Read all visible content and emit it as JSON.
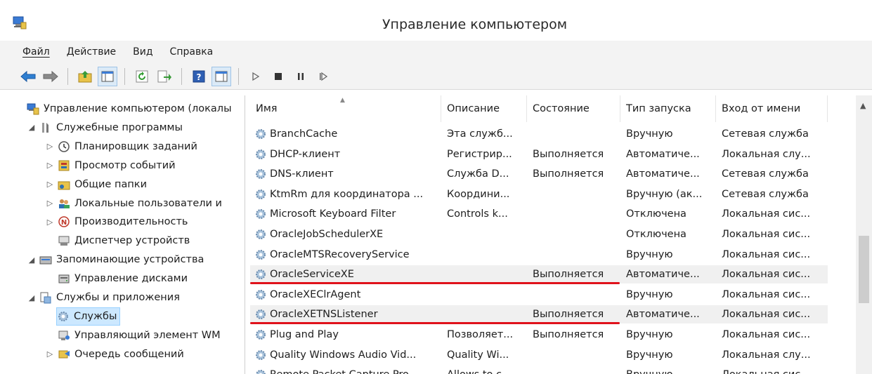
{
  "window": {
    "title": "Управление компьютером",
    "icon": "computer-management-icon"
  },
  "menu": {
    "file": "Файл",
    "action": "Действие",
    "view": "Вид",
    "help": "Справка"
  },
  "toolbar": {
    "buttons": [
      "back-arrow-icon",
      "forward-arrow-icon",
      "up-folder-icon",
      "show-hide-tree-icon",
      "refresh-icon",
      "export-list-icon",
      "help-icon",
      "properties-icon",
      "play-icon",
      "stop-icon",
      "pause-icon",
      "resume-icon"
    ]
  },
  "tree": {
    "items": [
      {
        "label": "Управление компьютером (локалы",
        "icon": "computer-management-icon",
        "level": 0,
        "arrow": ""
      },
      {
        "label": "Служебные программы",
        "icon": "tools-icon",
        "level": 1,
        "arrow": "◢"
      },
      {
        "label": "Планировщик заданий",
        "icon": "clock-icon",
        "level": 2,
        "arrow": "▷"
      },
      {
        "label": "Просмотр событий",
        "icon": "event-viewer-icon",
        "level": 2,
        "arrow": "▷"
      },
      {
        "label": "Общие папки",
        "icon": "shared-folder-icon",
        "level": 2,
        "arrow": "▷"
      },
      {
        "label": "Локальные пользователи и",
        "icon": "users-icon",
        "level": 2,
        "arrow": "▷"
      },
      {
        "label": "Производительность",
        "icon": "performance-icon",
        "level": 2,
        "arrow": "▷"
      },
      {
        "label": "Диспетчер устройств",
        "icon": "device-manager-icon",
        "level": 2,
        "arrow": ""
      },
      {
        "label": "Запоминающие устройства",
        "icon": "storage-icon",
        "level": 1,
        "arrow": "◢"
      },
      {
        "label": "Управление дисками",
        "icon": "disk-icon",
        "level": 2,
        "arrow": ""
      },
      {
        "label": "Службы и приложения",
        "icon": "services-apps-icon",
        "level": 1,
        "arrow": "◢"
      },
      {
        "label": "Службы",
        "icon": "gear-icon",
        "level": 2,
        "arrow": "",
        "selected": true
      },
      {
        "label": "Управляющий элемент WM",
        "icon": "wmi-icon",
        "level": 2,
        "arrow": ""
      },
      {
        "label": "Очередь сообщений",
        "icon": "message-queue-icon",
        "level": 2,
        "arrow": "▷"
      }
    ]
  },
  "columns": {
    "name": "Имя",
    "description": "Описание",
    "status": "Состояние",
    "startup": "Тип запуска",
    "logon": "Вход от имени"
  },
  "services": [
    {
      "name": "BranchCache",
      "description": "Эта служб...",
      "status": "",
      "startup": "Вручную",
      "logon": "Сетевая служба",
      "highlight": false
    },
    {
      "name": "DHCP-клиент",
      "description": "Регистрир...",
      "status": "Выполняется",
      "startup": "Автоматиче...",
      "logon": "Локальная слу...",
      "highlight": false
    },
    {
      "name": "DNS-клиент",
      "description": "Служба D...",
      "status": "Выполняется",
      "startup": "Автоматиче...",
      "logon": "Сетевая служба",
      "highlight": false
    },
    {
      "name": "KtmRm для координатора ...",
      "description": "Координи...",
      "status": "",
      "startup": "Вручную (ак...",
      "logon": "Сетевая служба",
      "highlight": false
    },
    {
      "name": "Microsoft Keyboard Filter",
      "description": "Controls k...",
      "status": "",
      "startup": "Отключена",
      "logon": "Локальная сис...",
      "highlight": false
    },
    {
      "name": "OracleJobSchedulerXE",
      "description": "",
      "status": "",
      "startup": "Отключена",
      "logon": "Локальная сис...",
      "highlight": false
    },
    {
      "name": "OracleMTSRecoveryService",
      "description": "",
      "status": "",
      "startup": "Вручную",
      "logon": "Локальная сис...",
      "highlight": false
    },
    {
      "name": "OracleServiceXE",
      "description": "",
      "status": "Выполняется",
      "startup": "Автоматиче...",
      "logon": "Локальная сис...",
      "highlight": true
    },
    {
      "name": "OracleXEClrAgent",
      "description": "",
      "status": "",
      "startup": "Вручную",
      "logon": "Локальная сис...",
      "highlight": false
    },
    {
      "name": "OracleXETNSListener",
      "description": "",
      "status": "Выполняется",
      "startup": "Автоматиче...",
      "logon": "Локальная сис...",
      "highlight": true
    },
    {
      "name": "Plug and Play",
      "description": "Позволяет...",
      "status": "Выполняется",
      "startup": "Вручную",
      "logon": "Локальная сис...",
      "highlight": false
    },
    {
      "name": "Quality Windows Audio Vid...",
      "description": "Quality Wi...",
      "status": "",
      "startup": "Вручную",
      "logon": "Локальная слу...",
      "highlight": false
    },
    {
      "name": "Remote Packet Capture Pro...",
      "description": "Allows to c...",
      "status": "",
      "startup": "Вручную",
      "logon": "Локальная сис...",
      "highlight": false
    }
  ],
  "colors": {
    "annotation": "#e0121b",
    "selection": "#cce8ff",
    "highlight_row": "#f0f0f0"
  }
}
